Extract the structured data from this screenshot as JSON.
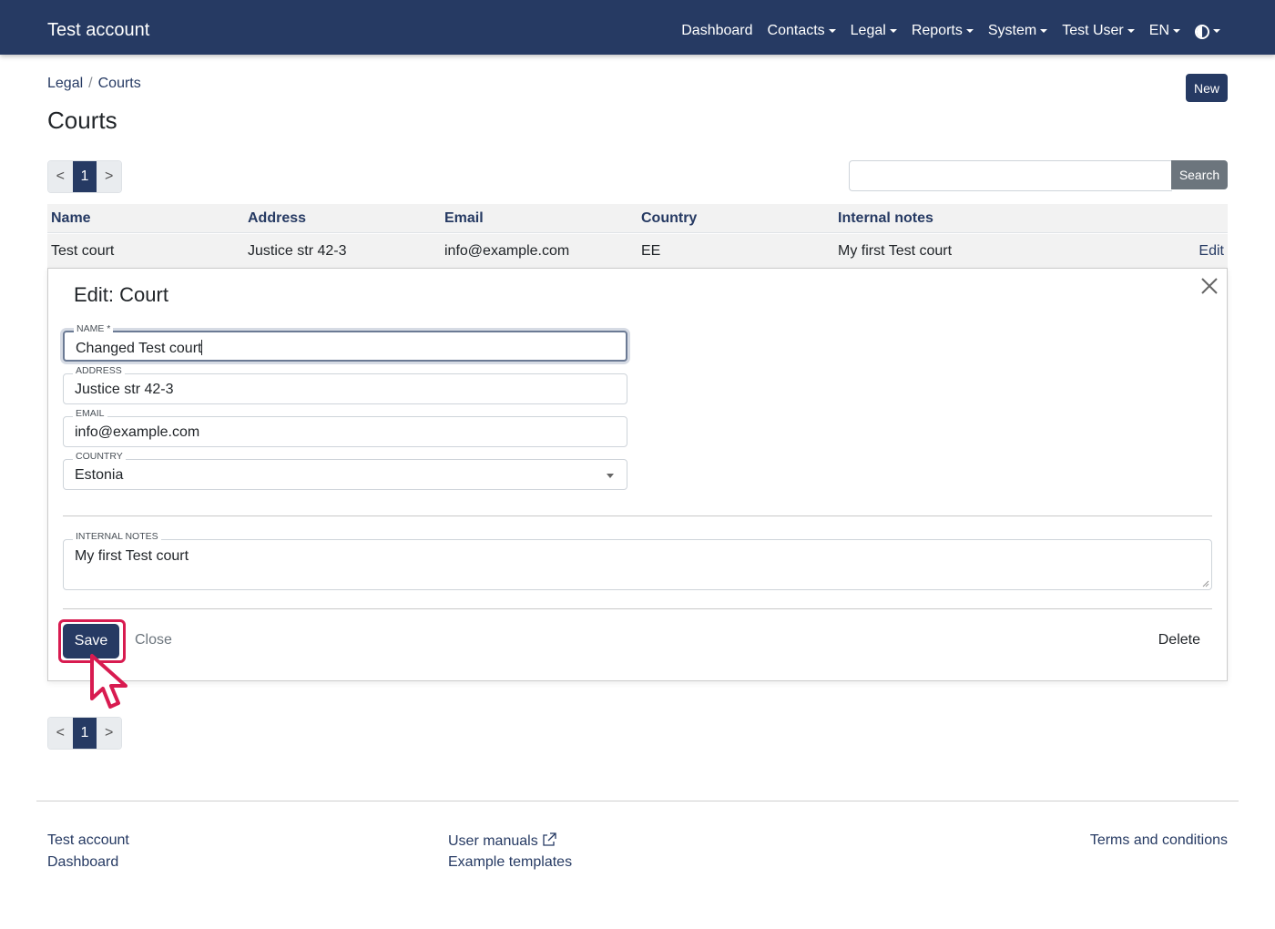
{
  "navbar": {
    "brand": "Test account",
    "items": [
      "Dashboard",
      "Contacts",
      "Legal",
      "Reports",
      "System",
      "Test User",
      "EN"
    ]
  },
  "breadcrumb": {
    "parent": "Legal",
    "sep": "/",
    "current": "Courts"
  },
  "page": {
    "title": "Courts",
    "new_label": "New"
  },
  "pagination": {
    "prev": "<",
    "page": "1",
    "next": ">"
  },
  "search": {
    "placeholder": "",
    "button": "Search"
  },
  "table": {
    "headers": [
      "Name",
      "Address",
      "Email",
      "Country",
      "Internal notes"
    ],
    "row": {
      "name": "Test court",
      "address": "Justice str 42-3",
      "email": "info@example.com",
      "country": "EE",
      "notes": "My first Test court",
      "edit": "Edit"
    }
  },
  "edit_form": {
    "title": "Edit: Court",
    "name_label": "Name *",
    "name_value": "Changed Test court",
    "address_label": "Address",
    "address_value": "Justice str 42-3",
    "email_label": "Email",
    "email_value": "info@example.com",
    "country_label": "Country",
    "country_value": "Estonia",
    "notes_label": "Internal notes",
    "notes_value": "My first Test court",
    "save": "Save",
    "close": "Close",
    "delete": "Delete"
  },
  "footer": {
    "col1": [
      "Test account",
      "Dashboard"
    ],
    "col2": [
      "User manuals",
      "Example templates"
    ],
    "col3": [
      "Terms and conditions"
    ]
  },
  "colors": {
    "primary": "#263a63",
    "highlight": "#d81b50",
    "secondary": "#6c757d"
  },
  "icons": {
    "theme": "contrast-icon",
    "close": "close-icon",
    "external": "external-link-icon",
    "pointer": "mouse-pointer-icon"
  }
}
